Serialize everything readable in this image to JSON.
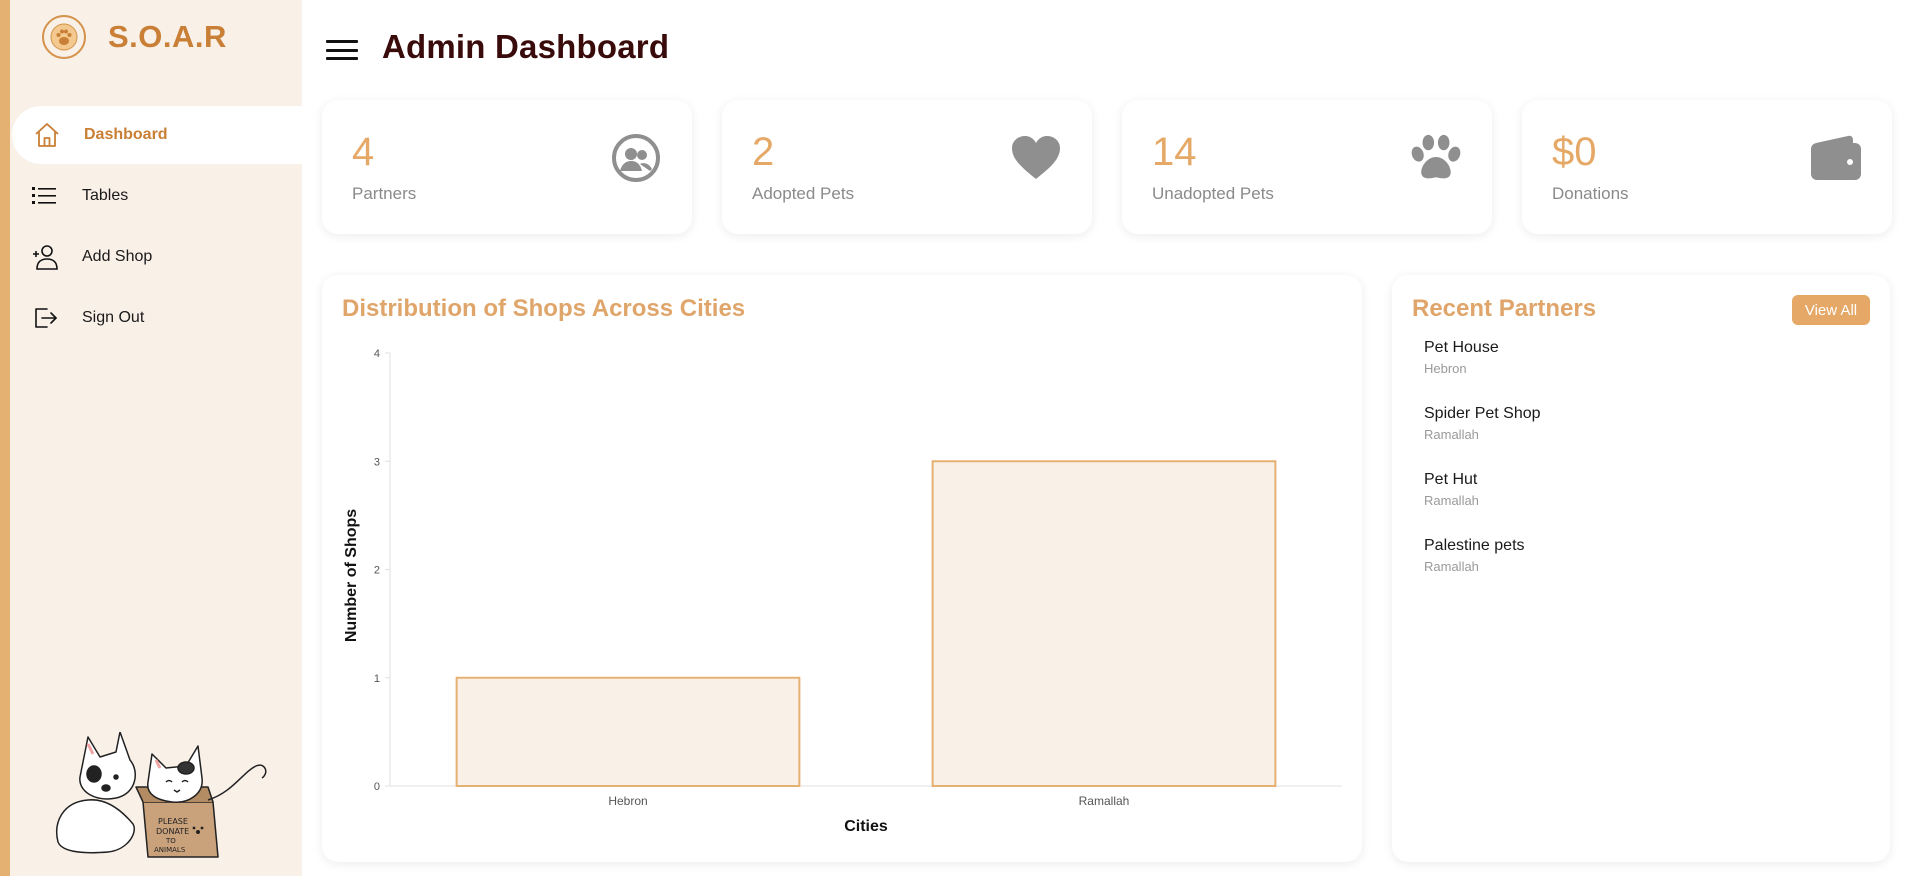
{
  "brand": {
    "name": "S.O.A.R"
  },
  "sidebar": {
    "items": [
      {
        "label": "Dashboard",
        "icon": "home-icon",
        "active": true
      },
      {
        "label": "Tables",
        "icon": "list-icon",
        "active": false
      },
      {
        "label": "Add Shop",
        "icon": "add-user-icon",
        "active": false
      },
      {
        "label": "Sign Out",
        "icon": "sign-out-icon",
        "active": false
      }
    ],
    "mascot": {
      "sign_text": "PLEASE DONATE TO ANIMALS"
    }
  },
  "header": {
    "title": "Admin Dashboard"
  },
  "stats": [
    {
      "value": "4",
      "label": "Partners",
      "icon": "partners-icon"
    },
    {
      "value": "2",
      "label": "Adopted Pets",
      "icon": "heart-icon"
    },
    {
      "value": "14",
      "label": "Unadopted Pets",
      "icon": "paw-icon"
    },
    {
      "value": "$0",
      "label": "Donations",
      "icon": "wallet-icon"
    }
  ],
  "chart": {
    "title": "Distribution of Shops Across Cities"
  },
  "chart_data": {
    "type": "bar",
    "categories": [
      "Hebron",
      "Ramallah"
    ],
    "values": [
      1,
      3
    ],
    "title": "Distribution of Shops Across Cities",
    "xlabel": "Cities",
    "ylabel": "Number of Shops",
    "ylim": [
      0,
      4
    ],
    "yticks": [
      "0",
      "1",
      "2",
      "3",
      "4"
    ],
    "grid": false,
    "bar_fill": "#f9f0e8",
    "bar_stroke": "#e5b173"
  },
  "partners": {
    "title": "Recent Partners",
    "view_all_label": "View All",
    "items": [
      {
        "name": "Pet House",
        "city": "Hebron"
      },
      {
        "name": "Spider Pet Shop",
        "city": "Ramallah"
      },
      {
        "name": "Pet Hut",
        "city": "Ramallah"
      },
      {
        "name": "Palestine pets",
        "city": "Ramallah"
      }
    ]
  },
  "colors": {
    "accent": "#e5a866",
    "brand": "#c97f35",
    "sidebar_bg": "#f9f0e8",
    "title": "#3a0b0b",
    "icon_gray": "#8f8f8f"
  }
}
